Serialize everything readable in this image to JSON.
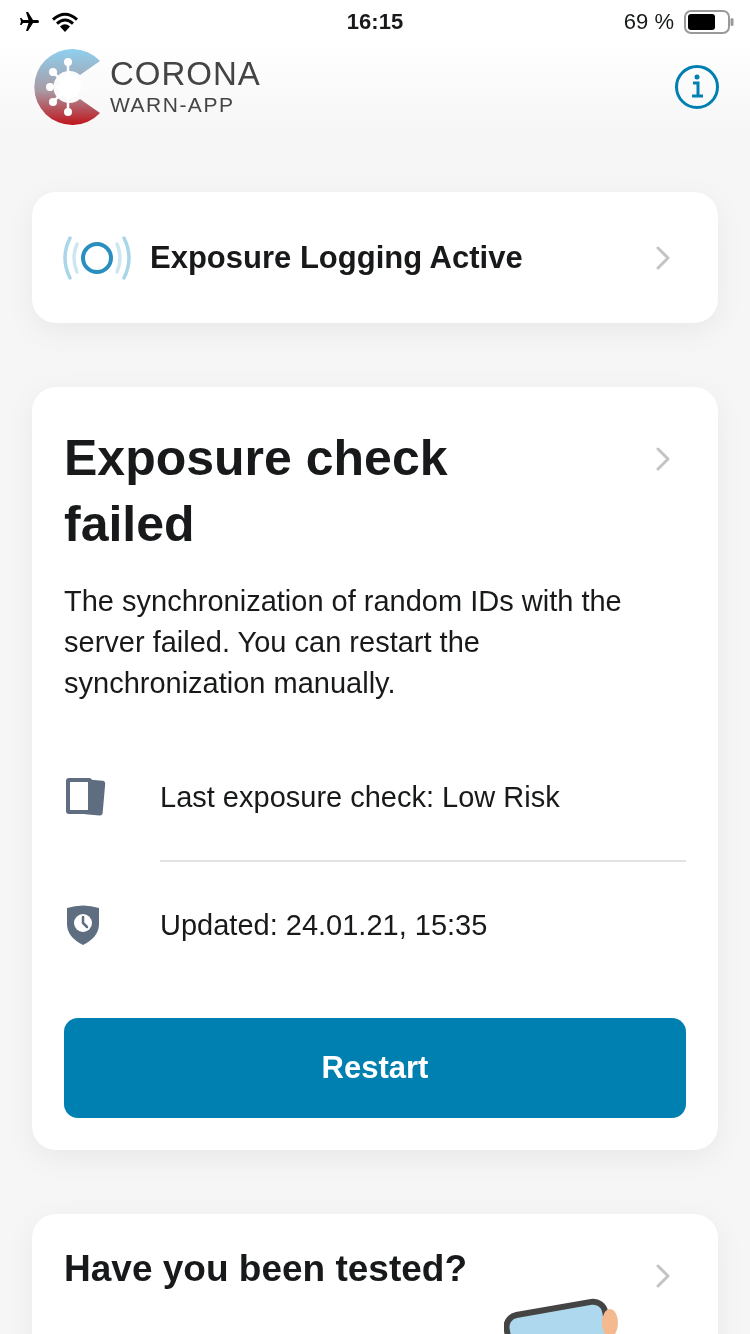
{
  "status_bar": {
    "time": "16:15",
    "battery_text": "69 %"
  },
  "header": {
    "logo_line1": "CORONA",
    "logo_line2": "WARN-APP"
  },
  "logging_card": {
    "label": "Exposure Logging Active"
  },
  "risk_card": {
    "title": "Exposure check failed",
    "body": "The synchronization of random IDs with the server failed. You can restart the synchronization manually.",
    "rows": [
      {
        "kind": "calendar",
        "text": "Last exposure check: Low Risk"
      },
      {
        "kind": "shield",
        "text": "Updated: 24.01.21, 15:35"
      }
    ],
    "button": "Restart"
  },
  "test_card": {
    "title": "Have you been tested?"
  }
}
